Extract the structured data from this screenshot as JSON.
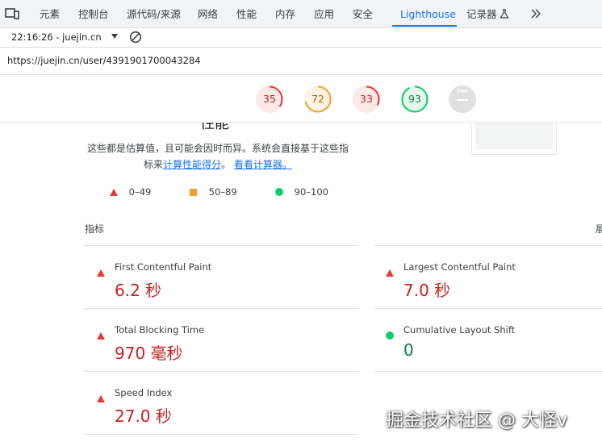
{
  "devtools": {
    "tabs": [
      "元素",
      "控制台",
      "源代码/来源",
      "网络",
      "性能",
      "内存",
      "应用",
      "安全",
      "Lighthouse",
      "记录器"
    ],
    "active_tab": "Lighthouse",
    "more_icon": "chevrons-right-icon"
  },
  "report": {
    "selector": "22:16:26 - juejin.cn"
  },
  "url": "https://juejin.cn/user/4391901700043284",
  "gauges": [
    {
      "score": "35",
      "color": "#e53935",
      "fraction": 0.35,
      "bg": "#fde9e7"
    },
    {
      "score": "72",
      "color": "#f2a12c",
      "fraction": 0.72,
      "bg": "#fff4e3"
    },
    {
      "score": "33",
      "color": "#e53935",
      "fraction": 0.33,
      "bg": "#fde9e7"
    },
    {
      "score": "93",
      "color": "#0cce6b",
      "fraction": 0.93,
      "bg": "#e6f8ee"
    }
  ],
  "pwa": {
    "label": "PWA"
  },
  "section": {
    "title": "性能",
    "desc_line1": "这些都是估算值，且可能会因时而异。系统会直接基于这些指",
    "desc_line2_prefix": "标来",
    "link_calc_score": "计算性能得分",
    "desc_sep": "。",
    "link_view_calc": "看看计算器。"
  },
  "legend": {
    "fail": "0–49",
    "average": "50–89",
    "pass": "90–100"
  },
  "metrics": {
    "header": "指标",
    "expand": "展",
    "items": [
      {
        "name": "First Contentful Paint",
        "value": "6.2 秒",
        "status": "fail"
      },
      {
        "name": "Largest Contentful Paint",
        "value": "7.0 秒",
        "status": "fail"
      },
      {
        "name": "Total Blocking Time",
        "value": "970 毫秒",
        "status": "fail"
      },
      {
        "name": "Cumulative Layout Shift",
        "value": "0",
        "status": "pass"
      },
      {
        "name": "Speed Index",
        "value": "27.0 秒",
        "status": "fail"
      }
    ]
  },
  "colors": {
    "fail": "#e53935",
    "average": "#f2a12c",
    "pass": "#0cce6b",
    "accent": "#1a73e8"
  },
  "watermark": "掘金技术社区 @ 大怪v"
}
